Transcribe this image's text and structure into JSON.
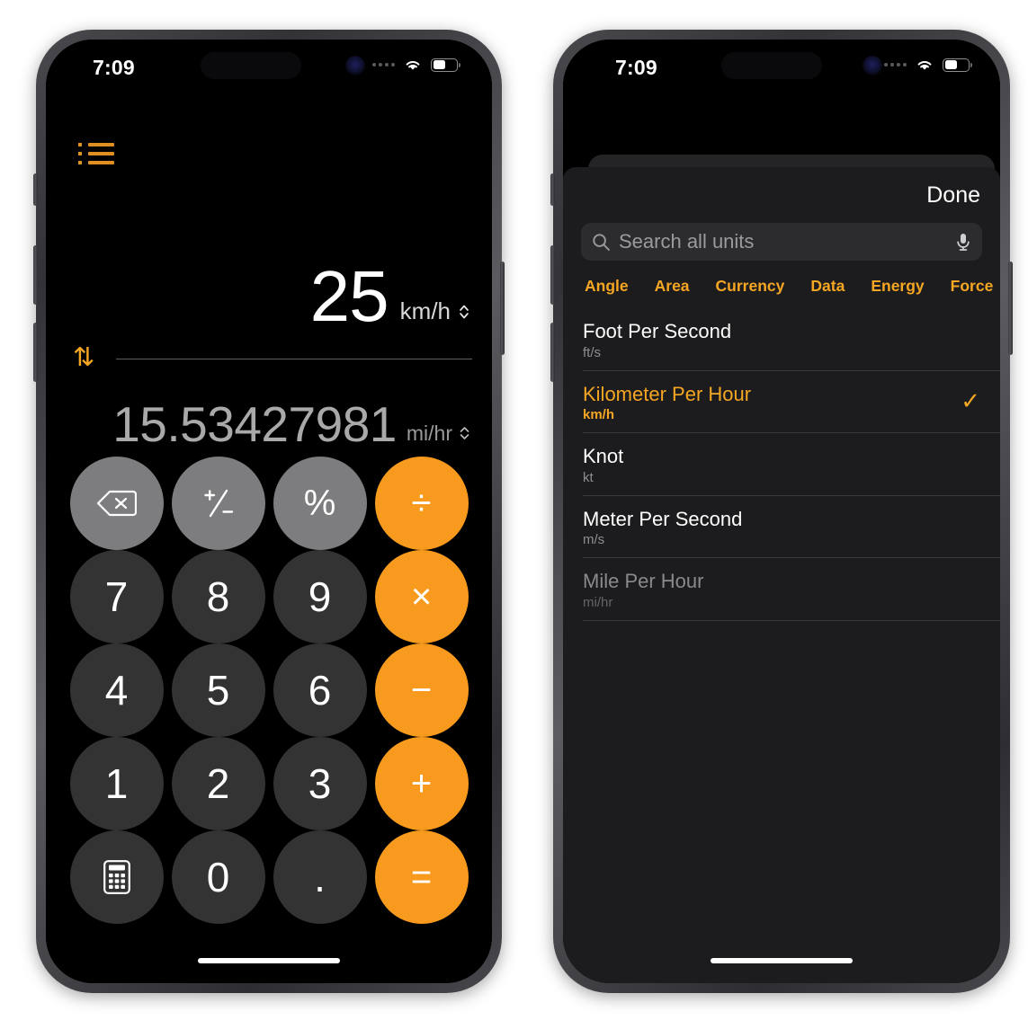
{
  "statusbar": {
    "time": "7:09",
    "battery_percent": 50
  },
  "left_phone": {
    "menu_icon": "list-bullets-icon",
    "display": {
      "primary_value": "25",
      "primary_unit": "km/h",
      "secondary_value": "15.53427981",
      "secondary_unit": "mi/hr",
      "swap_icon": "⇅",
      "chevron": "⌃⌄"
    },
    "keypad": [
      {
        "label": "delete-icon",
        "name": "backspace-key",
        "style": "fn"
      },
      {
        "label": "⁺/₋",
        "name": "sign-toggle-key",
        "style": "fn"
      },
      {
        "label": "%",
        "name": "percent-key",
        "style": "fn"
      },
      {
        "label": "÷",
        "name": "divide-key",
        "style": "op"
      },
      {
        "label": "7",
        "name": "digit-7-key",
        "style": "num"
      },
      {
        "label": "8",
        "name": "digit-8-key",
        "style": "num"
      },
      {
        "label": "9",
        "name": "digit-9-key",
        "style": "num"
      },
      {
        "label": "×",
        "name": "multiply-key",
        "style": "op"
      },
      {
        "label": "4",
        "name": "digit-4-key",
        "style": "num"
      },
      {
        "label": "5",
        "name": "digit-5-key",
        "style": "num"
      },
      {
        "label": "6",
        "name": "digit-6-key",
        "style": "num"
      },
      {
        "label": "−",
        "name": "subtract-key",
        "style": "op"
      },
      {
        "label": "1",
        "name": "digit-1-key",
        "style": "num"
      },
      {
        "label": "2",
        "name": "digit-2-key",
        "style": "num"
      },
      {
        "label": "3",
        "name": "digit-3-key",
        "style": "num"
      },
      {
        "label": "+",
        "name": "add-key",
        "style": "op"
      },
      {
        "label": "calculator-icon",
        "name": "calculator-mode-key",
        "style": "num"
      },
      {
        "label": "0",
        "name": "digit-0-key",
        "style": "num"
      },
      {
        "label": ".",
        "name": "decimal-key",
        "style": "num"
      },
      {
        "label": "=",
        "name": "equals-key",
        "style": "op"
      }
    ]
  },
  "right_phone": {
    "done_label": "Done",
    "search": {
      "placeholder": "Search all units",
      "value": ""
    },
    "categories": [
      "Angle",
      "Area",
      "Currency",
      "Data",
      "Energy",
      "Force"
    ],
    "units": [
      {
        "name": "Foot Per Second",
        "abbr": "ft/s",
        "state": "normal"
      },
      {
        "name": "Kilometer Per Hour",
        "abbr": "km/h",
        "state": "selected"
      },
      {
        "name": "Knot",
        "abbr": "kt",
        "state": "normal"
      },
      {
        "name": "Meter Per Second",
        "abbr": "m/s",
        "state": "normal"
      },
      {
        "name": "Mile Per Hour",
        "abbr": "mi/hr",
        "state": "disabled"
      }
    ],
    "checkmark": "✓"
  },
  "colors": {
    "accent_orange": "#f5a623",
    "operator_orange": "#f79a1e",
    "function_gray": "#7d7d7f",
    "number_gray": "#333333",
    "sheet_bg": "#1c1c1e",
    "search_bg": "#2c2c2e"
  }
}
